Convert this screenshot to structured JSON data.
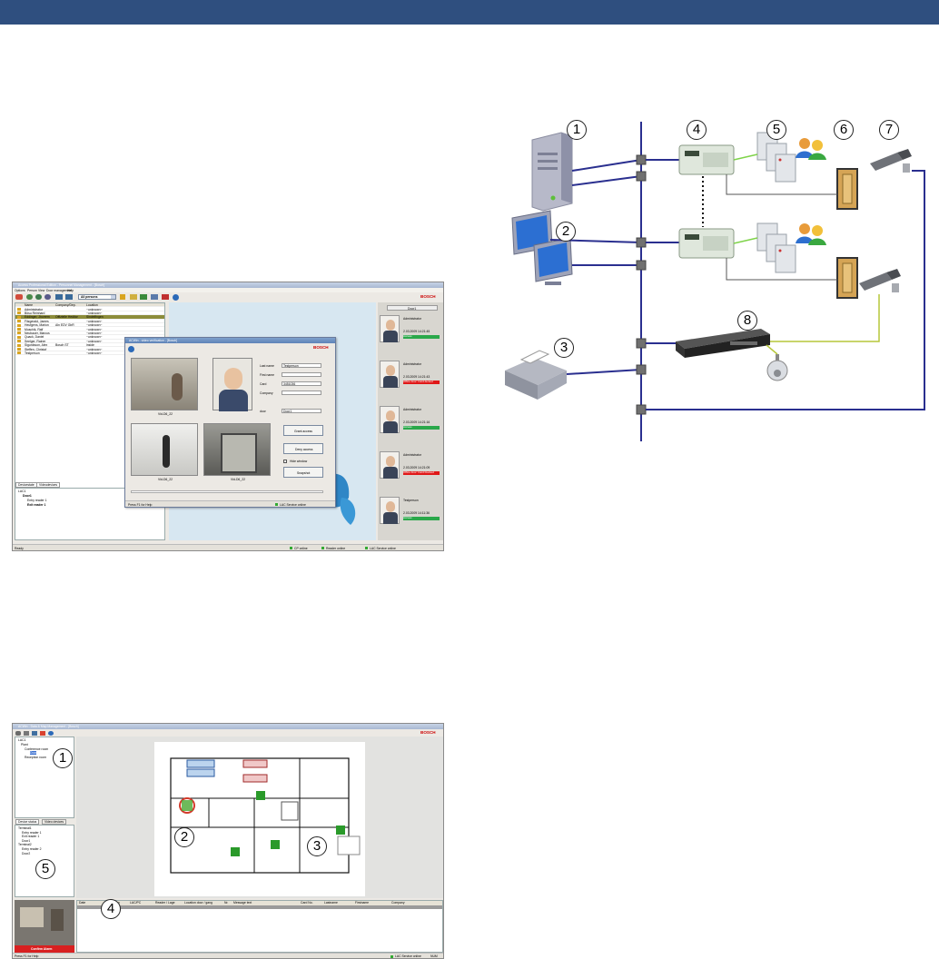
{
  "header": {
    "bar_color": "#2f4f7f"
  },
  "brand": {
    "name": "BOSCH"
  },
  "acc": {
    "title": "Access Professional Edition - Personnel Management - [Bosch]",
    "menu": [
      "Options",
      "Person",
      "View",
      "Door management",
      "Help"
    ],
    "filter": "All persons",
    "columns": [
      "Name",
      "Company/Dep.",
      "Location"
    ],
    "persons": [
      {
        "name": "Administrator",
        "company": "",
        "location": "~unknown~"
      },
      {
        "name": "Bösu Reinhard",
        "company": "",
        "location": "~unknown~"
      },
      {
        "name": "Eddinger, Jhorrem",
        "company": "Offizielle Heditor",
        "location": "Sindelfingen"
      },
      {
        "name": "Fitzgerald, James",
        "company": "",
        "location": "~unknown~"
      },
      {
        "name": "Heufgens, Marion",
        "company": "Aln EDV GbR",
        "location": "~unknown~"
      },
      {
        "name": "Muschik, Ralf",
        "company": "",
        "location": "~unknown~"
      },
      {
        "name": "Neubauer, Marcus",
        "company": "",
        "location": "~unknown~"
      },
      {
        "name": "Quack, Daniel",
        "company": "",
        "location": "~unknown~"
      },
      {
        "name": "Seelger, Rainer",
        "company": "",
        "location": "~unknown~"
      },
      {
        "name": "Sigurdsson, Alex",
        "company": "Bosch ST",
        "location": "inside"
      },
      {
        "name": "Steffen, Christof",
        "company": "",
        "location": "~unknown~"
      },
      {
        "name": "Testperson",
        "company": "",
        "location": "~unknown~"
      }
    ],
    "tabs": [
      "Devicestate",
      "Videodevices"
    ],
    "tree": [
      "LAC1",
      "Door1",
      "Entry reader 1",
      "Exit reader 1"
    ],
    "status": [
      "Ready",
      "CP online",
      "Reader online",
      "LAC Service online"
    ],
    "events": [
      {
        "who": "Administrator",
        "time": "2.03.2009 14:21:45",
        "status": "Access"
      },
      {
        "who": "Administrator",
        "time": "2.03.2009 14:21:43",
        "status": "Office door: Card denied"
      },
      {
        "who": "Administrator",
        "time": "2.03.2009 14:21:16",
        "status": "Access"
      },
      {
        "who": "Administrator",
        "time": "2.03.2009 14:21:09",
        "status": "Office door: Card blocked"
      },
      {
        "who": "Testperson",
        "time": "2.03.2009 14:11:36",
        "status": "Access"
      }
    ],
    "dialog": {
      "title": "ACWin - video verification - [Bosch]",
      "fields": [
        {
          "label": "Last name",
          "value": "Testperson"
        },
        {
          "label": "First name",
          "value": ""
        },
        {
          "label": "Card",
          "value": "3451036"
        },
        {
          "label": "Company",
          "value": ""
        },
        {
          "label": "door",
          "value": "Door1"
        }
      ],
      "cams": [
        "Vid-D6_22",
        "Vid-D6_22",
        "Vid-D6_22"
      ],
      "buttons": [
        "Grant access",
        "Deny access",
        "Snapshot"
      ],
      "hide": "Hide window",
      "help": "Press F1 for Help",
      "svc": "LAC Service online"
    }
  },
  "diagram": {
    "numbers": [
      "1",
      "2",
      "3",
      "4",
      "5",
      "6",
      "7",
      "8"
    ]
  },
  "map": {
    "title": "ACWin - Data & Map Management - [Bosch]",
    "tree": [
      "LAC1",
      "Plant",
      "Conference room",
      "Door",
      "Reception room"
    ],
    "tabs": [
      "Device status",
      "Video devices"
    ],
    "device_tree": [
      "Terminal1",
      "Entry reader 1",
      "Exit reader 1",
      "Door1",
      "Terminal2",
      "Entry reader 2",
      "Door2"
    ],
    "callouts": [
      "1",
      "2",
      "3",
      "4",
      "5"
    ],
    "columns": [
      "Date",
      "Location",
      "LAC/PC",
      "Reader / Lage",
      "Location door / gang",
      "Nr.",
      "Message text",
      "Card No.",
      "Lastname",
      "Firstname",
      "Company"
    ],
    "alarm": "Confirm Alarm",
    "help": "Press F1 for Help",
    "svc": "LAC Service online",
    "num": "NUM"
  }
}
